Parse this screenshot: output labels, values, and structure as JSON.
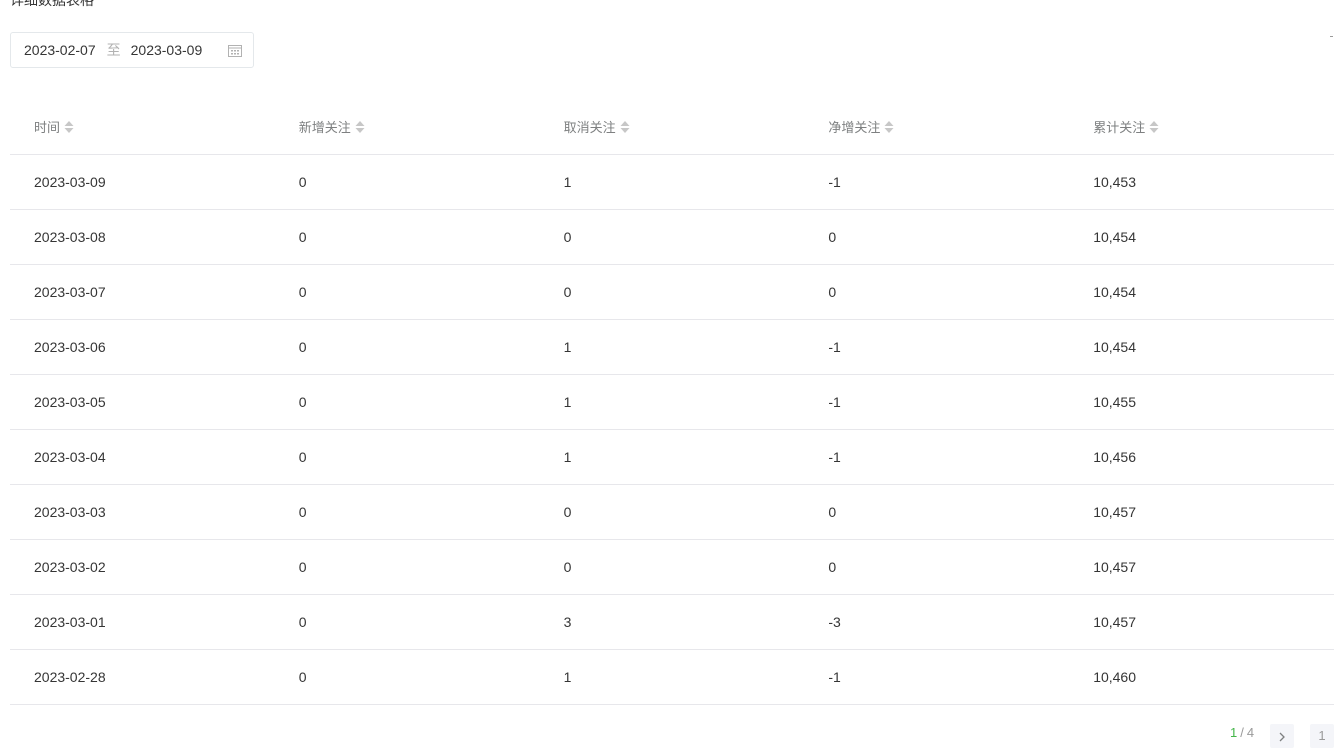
{
  "page": {
    "title": "详细数据表格"
  },
  "date_range": {
    "start": "2023-02-07",
    "separator": "至",
    "end": "2023-03-09",
    "icon": "calendar-icon"
  },
  "table": {
    "columns": [
      "时间",
      "新增关注",
      "取消关注",
      "净增关注",
      "累计关注"
    ],
    "rows": [
      [
        "2023-03-09",
        "0",
        "1",
        "-1",
        "10,453"
      ],
      [
        "2023-03-08",
        "0",
        "0",
        "0",
        "10,454"
      ],
      [
        "2023-03-07",
        "0",
        "0",
        "0",
        "10,454"
      ],
      [
        "2023-03-06",
        "0",
        "1",
        "-1",
        "10,454"
      ],
      [
        "2023-03-05",
        "0",
        "1",
        "-1",
        "10,455"
      ],
      [
        "2023-03-04",
        "0",
        "1",
        "-1",
        "10,456"
      ],
      [
        "2023-03-03",
        "0",
        "0",
        "0",
        "10,457"
      ],
      [
        "2023-03-02",
        "0",
        "0",
        "0",
        "10,457"
      ],
      [
        "2023-03-01",
        "0",
        "3",
        "-3",
        "10,457"
      ],
      [
        "2023-02-28",
        "0",
        "1",
        "-1",
        "10,460"
      ]
    ]
  },
  "pagination": {
    "current": "1",
    "separator": "/",
    "total": "4",
    "next_icon": "chevron-right-icon",
    "page_input": "1"
  },
  "colors": {
    "accent": "#44b549",
    "border": "#e7e7eb",
    "header_text": "#7e8081",
    "text": "#353535"
  }
}
